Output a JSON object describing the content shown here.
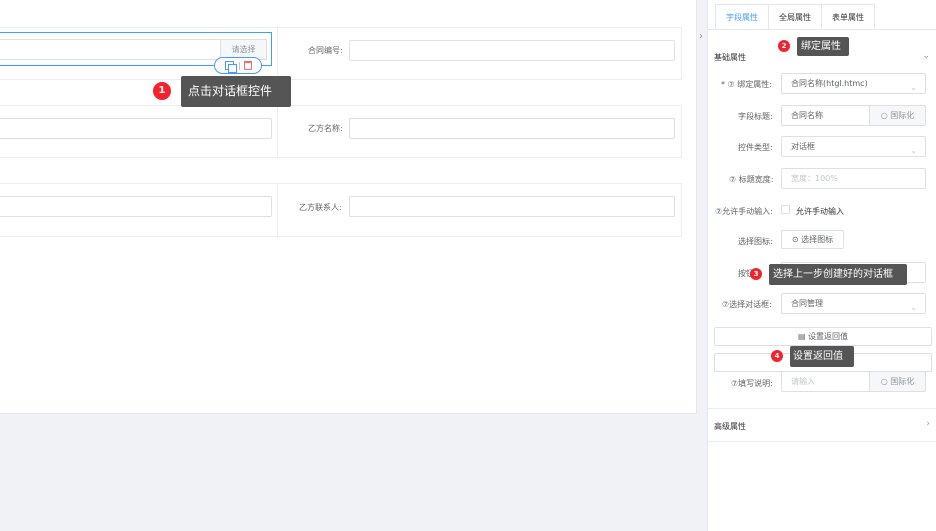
{
  "form": {
    "choose_button": "请选择",
    "contract_no_label": "合同编号:",
    "party_b_name_label": "乙方名称:",
    "party_b_contact_label": "乙方联系人:"
  },
  "callouts": {
    "c1": {
      "num": "1",
      "text": "点击对话框控件"
    },
    "c2": {
      "num": "2",
      "text": "绑定属性"
    },
    "c3": {
      "num": "3",
      "text": "选择上一步创建好的对话框"
    },
    "c4": {
      "num": "4",
      "text": "设置返回值"
    }
  },
  "panel": {
    "tabs": [
      "字段属性",
      "全局属性",
      "表单属性"
    ],
    "basic_section": "基础属性",
    "advanced_section": "高级属性",
    "bind_label": "* ⑦ 绑定属性:",
    "bind_value": "合同名称(htgl.htmc)",
    "title_label": "字段标题:",
    "title_value": "合同名称",
    "i18n_button": "国际化",
    "control_type_label": "控件类型:",
    "control_type_value": "对话框",
    "title_width_label": "⑦ 标题宽度:",
    "title_width_placeholder": "宽度：100%",
    "allow_manual_label": "⑦允许手动输入:",
    "allow_manual_text": "允许手动输入",
    "choose_icon_label": "选择图标:",
    "choose_icon_button": "选择图标",
    "button_text_label": "按钮",
    "choose_dialog_label": "⑦选择对话框:",
    "choose_dialog_value": "合同管理",
    "set_return_button": "设置返回值",
    "fill_desc_label": "⑦填写说明:",
    "fill_desc_placeholder": "请输入",
    "i18n_button_2": "国际化"
  },
  "colors": {
    "accent": "#409eff",
    "badge": "#f5222d",
    "callout_bg": "#555555"
  }
}
